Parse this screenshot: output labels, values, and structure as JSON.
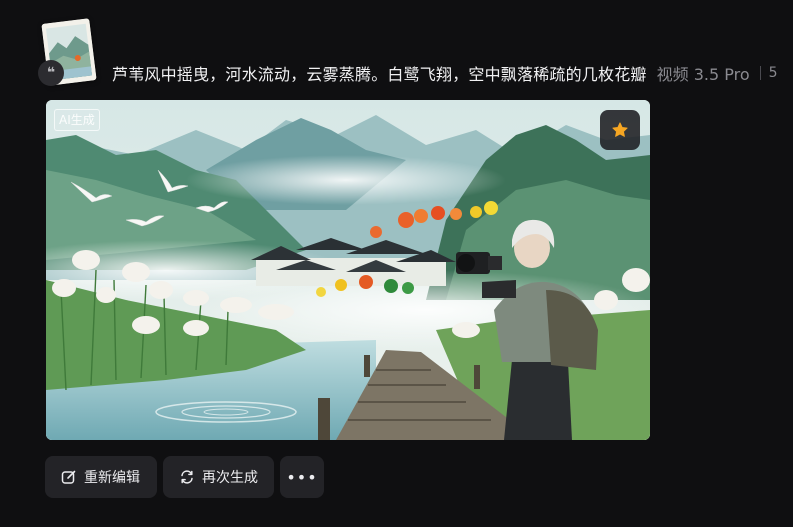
{
  "prompt": {
    "text": "芦苇风中摇曳，河水流动，云雾蒸腾。白鹭飞翔，空中飘落稀疏的几枚花瓣",
    "model": "视频 3.5 Pro",
    "more_meta": "5"
  },
  "thumbnail": {
    "quote_icon": "quote-icon"
  },
  "media": {
    "ai_badge": "AI生成",
    "favorite_icon": "star-icon",
    "favorite_color": "#f6a623"
  },
  "actions": {
    "edit_label": "重新编辑",
    "regenerate_label": "再次生成",
    "more_label": "•••"
  },
  "colors": {
    "background": "#0f0f11",
    "button_bg": "#232327",
    "text_primary": "#f1f1f3",
    "text_secondary": "#8a8a90"
  }
}
